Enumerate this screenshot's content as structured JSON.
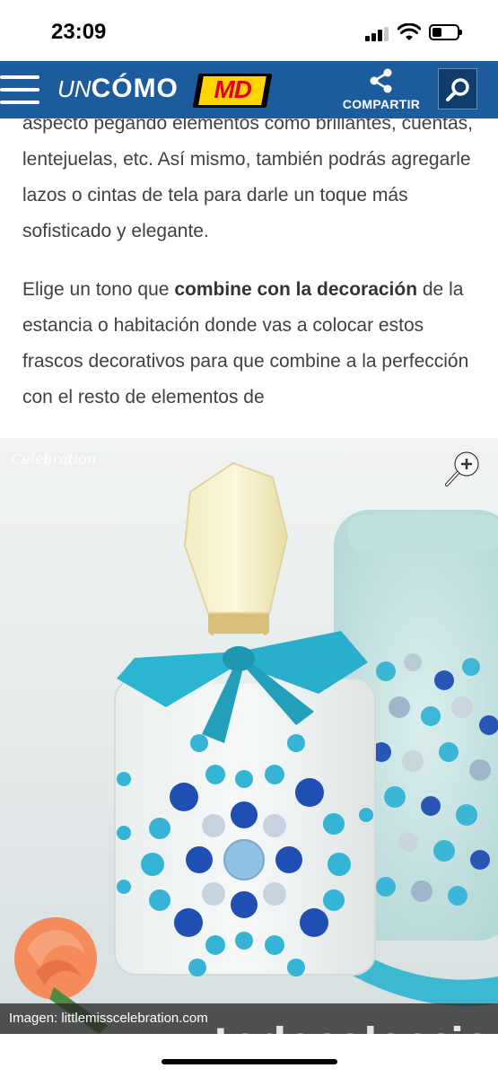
{
  "status_bar": {
    "time": "23:09"
  },
  "header": {
    "logo_prefix": "UN",
    "logo_main": "CÓMO",
    "partner_logo": "MD",
    "share_label": "COMPARTIR",
    "icons": {
      "menu": "hamburger-icon",
      "share": "share-icon",
      "search": "search-icon"
    },
    "colors": {
      "bar": "#1c5b9c",
      "search_bg": "#103d6b"
    }
  },
  "article": {
    "para1_clipped": "aspecto pegando elementos como brillantes,",
    "para1_text": "cuentas, lentejuelas, etc. Así mismo, también podrás agregarle lazos o cintas de tela para darle un toque más sofisticado y elegante.",
    "para2_before": "Elige un tono que ",
    "para2_bold": "combine con la decoración",
    "para2_after": " de la estancia o habitación donde vas a colocar estos frascos decorativos para que combine a la perfección con el resto de elementos de"
  },
  "image": {
    "watermark": "Celebration",
    "caption": "Imagen: littlemisscelebration.com",
    "overlay_mark": "todocoleccion",
    "zoom_icon": "zoom-in-icon",
    "colors": {
      "ribbon": "#2bb5d0",
      "gems_dark": "#1f4fb3",
      "gems_light": "#36b4d6"
    }
  }
}
